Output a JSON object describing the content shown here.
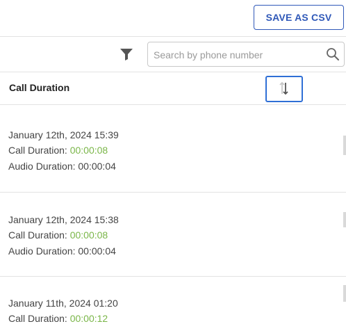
{
  "toolbar": {
    "save_csv_label": "SAVE AS CSV"
  },
  "search": {
    "placeholder": "Search by phone number",
    "value": ""
  },
  "table_header": {
    "title": "Call Duration"
  },
  "records": [
    {
      "date": "January 12th, 2024 15:39",
      "call_label": "Call Duration: ",
      "call_value": "00:00:08",
      "audio_text": "Audio Duration: 00:00:04"
    },
    {
      "date": "January 12th, 2024 15:38",
      "call_label": "Call Duration: ",
      "call_value": "00:00:08",
      "audio_text": "Audio Duration: 00:00:04"
    },
    {
      "date": "January 11th, 2024 01:20",
      "call_label": "Call Duration: ",
      "call_value": "00:00:12"
    }
  ],
  "colors": {
    "accent": "#2f58b8",
    "highlight_border": "#2f6fd6",
    "duration_green": "#7ab648"
  },
  "icons": {
    "filter": "filter-funnel-icon",
    "search": "search-icon",
    "sort": "sort-arrows-icon"
  }
}
